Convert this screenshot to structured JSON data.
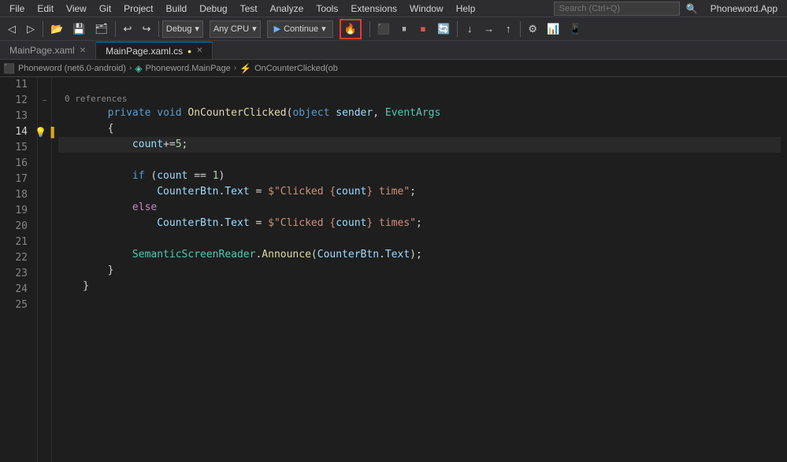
{
  "menubar": {
    "items": [
      "File",
      "Edit",
      "View",
      "Git",
      "Project",
      "Build",
      "Debug",
      "Test",
      "Analyze",
      "Tools",
      "Extensions",
      "Window",
      "Help"
    ],
    "search_placeholder": "Search (Ctrl+Q)",
    "app_name": "Phoneword.App"
  },
  "toolbar": {
    "debug_config": "Debug",
    "cpu_config": "Any CPU",
    "continue_label": "Continue",
    "hot_reload_icon": "🔥",
    "nav_back": "←",
    "nav_fwd": "→",
    "save_icon": "💾",
    "open_icon": "📂",
    "undo": "↩",
    "redo": "↪"
  },
  "tabs": [
    {
      "label": "MainPage.xaml",
      "active": false,
      "modified": false,
      "closeable": true
    },
    {
      "label": "MainPage.xaml.cs",
      "active": true,
      "modified": true,
      "closeable": true
    }
  ],
  "breadcrumb": {
    "project": "Phoneword (net6.0-android)",
    "class": "Phoneword.MainPage",
    "member": "OnCounterClicked(ob"
  },
  "code": {
    "ref_hint": "0 references",
    "lines": [
      {
        "num": 11,
        "content": "",
        "tokens": []
      },
      {
        "num": 12,
        "content": "        private void OnCounterClicked(object sender, EventArgs",
        "active": false,
        "has_collapse": true
      },
      {
        "num": 13,
        "content": "        {",
        "active": false
      },
      {
        "num": 14,
        "content": "            count+=5;",
        "active": true,
        "has_bulb": true,
        "has_bookmark": true
      },
      {
        "num": 15,
        "content": "",
        "active": false
      },
      {
        "num": 16,
        "content": "            if (count == 1)",
        "active": false
      },
      {
        "num": 17,
        "content": "                CounterBtn.Text = $\"Clicked {count} time\";",
        "active": false
      },
      {
        "num": 18,
        "content": "            else",
        "active": false
      },
      {
        "num": 19,
        "content": "                CounterBtn.Text = $\"Clicked {count} times\";",
        "active": false
      },
      {
        "num": 20,
        "content": "",
        "active": false
      },
      {
        "num": 21,
        "content": "            SemanticScreenReader.Announce(CounterBtn.Text);",
        "active": false
      },
      {
        "num": 22,
        "content": "        }",
        "active": false
      },
      {
        "num": 23,
        "content": "    }",
        "active": false
      },
      {
        "num": 24,
        "content": "",
        "active": false
      },
      {
        "num": 25,
        "content": "",
        "active": false
      }
    ]
  }
}
